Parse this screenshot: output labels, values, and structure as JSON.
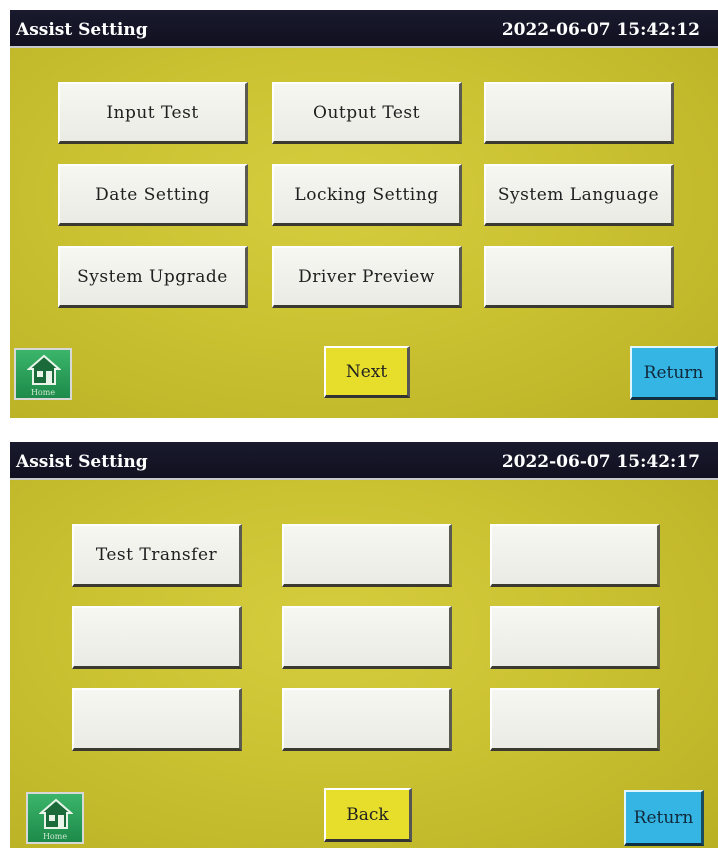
{
  "screen1": {
    "title": "Assist Setting",
    "datetime": "2022-06-07 15:42:12",
    "buttons": [
      {
        "label": "Input Test"
      },
      {
        "label": "Output Test"
      },
      {
        "label": ""
      },
      {
        "label": "Date Setting"
      },
      {
        "label": "Locking Setting"
      },
      {
        "label": "System Language"
      },
      {
        "label": "System Upgrade"
      },
      {
        "label": "Driver Preview"
      },
      {
        "label": ""
      }
    ],
    "home_label": "Home",
    "next_label": "Next",
    "return_label": "Return"
  },
  "screen2": {
    "title": "Assist Setting",
    "datetime": "2022-06-07 15:42:17",
    "buttons": [
      {
        "label": "Test Transfer"
      },
      {
        "label": ""
      },
      {
        "label": ""
      },
      {
        "label": ""
      },
      {
        "label": ""
      },
      {
        "label": ""
      },
      {
        "label": ""
      },
      {
        "label": ""
      },
      {
        "label": ""
      }
    ],
    "home_label": "Home",
    "back_label": "Back",
    "return_label": "Return"
  },
  "colors": {
    "panel_yellow": "#cbc232",
    "title_bar": "#101020",
    "home_green": "#1d8a4a",
    "nav_yellow": "#e6de2a",
    "return_blue": "#35b5e3"
  },
  "icons": {
    "home": "house-icon"
  }
}
